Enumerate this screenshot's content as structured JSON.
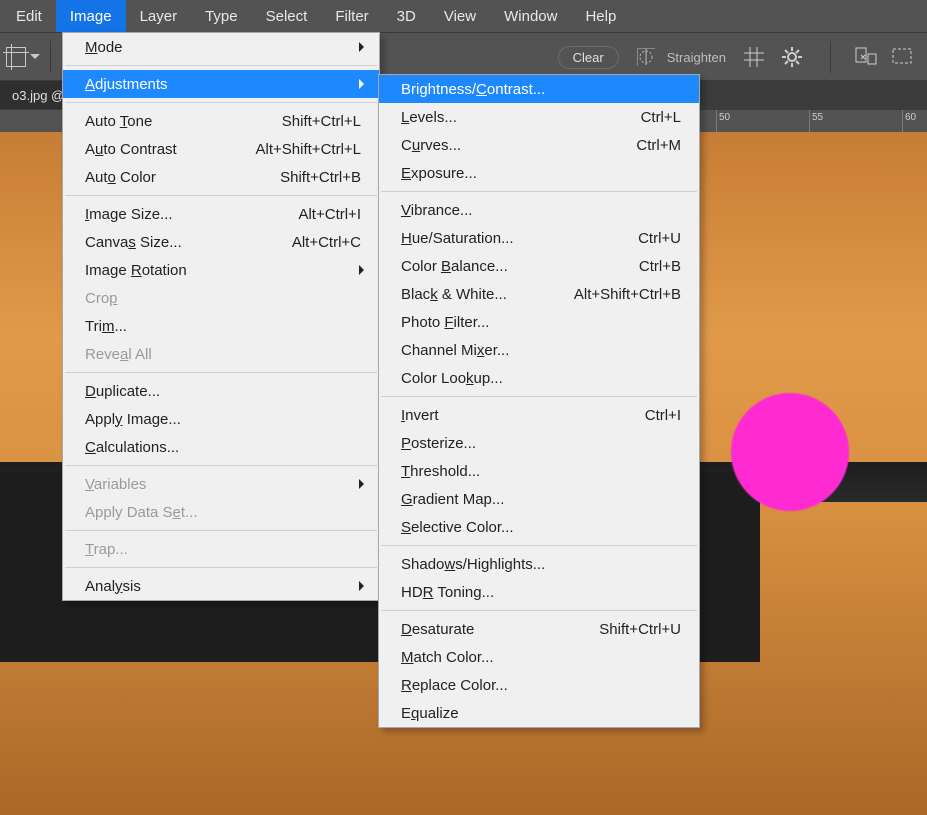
{
  "menubar": {
    "items": [
      "Edit",
      "Image",
      "Layer",
      "Type",
      "Select",
      "Filter",
      "3D",
      "View",
      "Window",
      "Help"
    ],
    "open_index": 1
  },
  "optionsbar": {
    "clear": "Clear",
    "straighten": "Straighten"
  },
  "tab": {
    "label": "o3.jpg @",
    "close": "×"
  },
  "ruler": {
    "ticks": [
      "50",
      "55",
      "60"
    ]
  },
  "image_menu": [
    {
      "label": "<u>M</u>ode",
      "submenu": true
    },
    {
      "sep": true
    },
    {
      "label": "<u>A</u>djustments",
      "submenu": true,
      "highlight": true
    },
    {
      "sep": true
    },
    {
      "label": "Auto <u>T</u>one",
      "shortcut": "Shift+Ctrl+L"
    },
    {
      "label": "A<u>u</u>to Contrast",
      "shortcut": "Alt+Shift+Ctrl+L"
    },
    {
      "label": "Aut<u>o</u> Color",
      "shortcut": "Shift+Ctrl+B"
    },
    {
      "sep": true
    },
    {
      "label": "<u>I</u>mage Size...",
      "shortcut": "Alt+Ctrl+I"
    },
    {
      "label": "Canva<u>s</u> Size...",
      "shortcut": "Alt+Ctrl+C"
    },
    {
      "label": "Image <u>R</u>otation",
      "submenu": true
    },
    {
      "label": "Cro<u>p</u>",
      "disabled": true
    },
    {
      "label": "Tri<u>m</u>..."
    },
    {
      "label": "Reve<u>a</u>l All",
      "disabled": true
    },
    {
      "sep": true
    },
    {
      "label": "<u>D</u>uplicate..."
    },
    {
      "label": "Appl<u>y</u> Image..."
    },
    {
      "label": "<u>C</u>alculations..."
    },
    {
      "sep": true
    },
    {
      "label": "<u>V</u>ariables",
      "submenu": true,
      "disabled": true
    },
    {
      "label": "Apply Data S<u>e</u>t...",
      "disabled": true
    },
    {
      "sep": true
    },
    {
      "label": "<u>T</u>rap...",
      "disabled": true
    },
    {
      "sep": true
    },
    {
      "label": "Anal<u>y</u>sis",
      "submenu": true
    }
  ],
  "adjustments_menu": [
    {
      "label": "Brightness/<u>C</u>ontrast...",
      "highlight": true
    },
    {
      "label": "<u>L</u>evels...",
      "shortcut": "Ctrl+L"
    },
    {
      "label": "C<u>u</u>rves...",
      "shortcut": "Ctrl+M"
    },
    {
      "label": "<u>E</u>xposure..."
    },
    {
      "sep": true
    },
    {
      "label": "<u>V</u>ibrance..."
    },
    {
      "label": "<u>H</u>ue/Saturation...",
      "shortcut": "Ctrl+U"
    },
    {
      "label": "Color <u>B</u>alance...",
      "shortcut": "Ctrl+B"
    },
    {
      "label": "Blac<u>k</u> & White...",
      "shortcut": "Alt+Shift+Ctrl+B"
    },
    {
      "label": "Photo <u>F</u>ilter..."
    },
    {
      "label": "Channel Mi<u>x</u>er..."
    },
    {
      "label": "Color Loo<u>k</u>up..."
    },
    {
      "sep": true
    },
    {
      "label": "<u>I</u>nvert",
      "shortcut": "Ctrl+I"
    },
    {
      "label": "<u>P</u>osterize..."
    },
    {
      "label": "<u>T</u>hreshold..."
    },
    {
      "label": "<u>G</u>radient Map..."
    },
    {
      "label": "<u>S</u>elective Color..."
    },
    {
      "sep": true
    },
    {
      "label": "Shado<u>w</u>s/Highlights..."
    },
    {
      "label": "HD<u>R</u> Toning..."
    },
    {
      "sep": true
    },
    {
      "label": "<u>D</u>esaturate",
      "shortcut": "Shift+Ctrl+U"
    },
    {
      "label": "<u>M</u>atch Color..."
    },
    {
      "label": "<u>R</u>eplace Color..."
    },
    {
      "label": "E<u>q</u>ualize"
    }
  ]
}
